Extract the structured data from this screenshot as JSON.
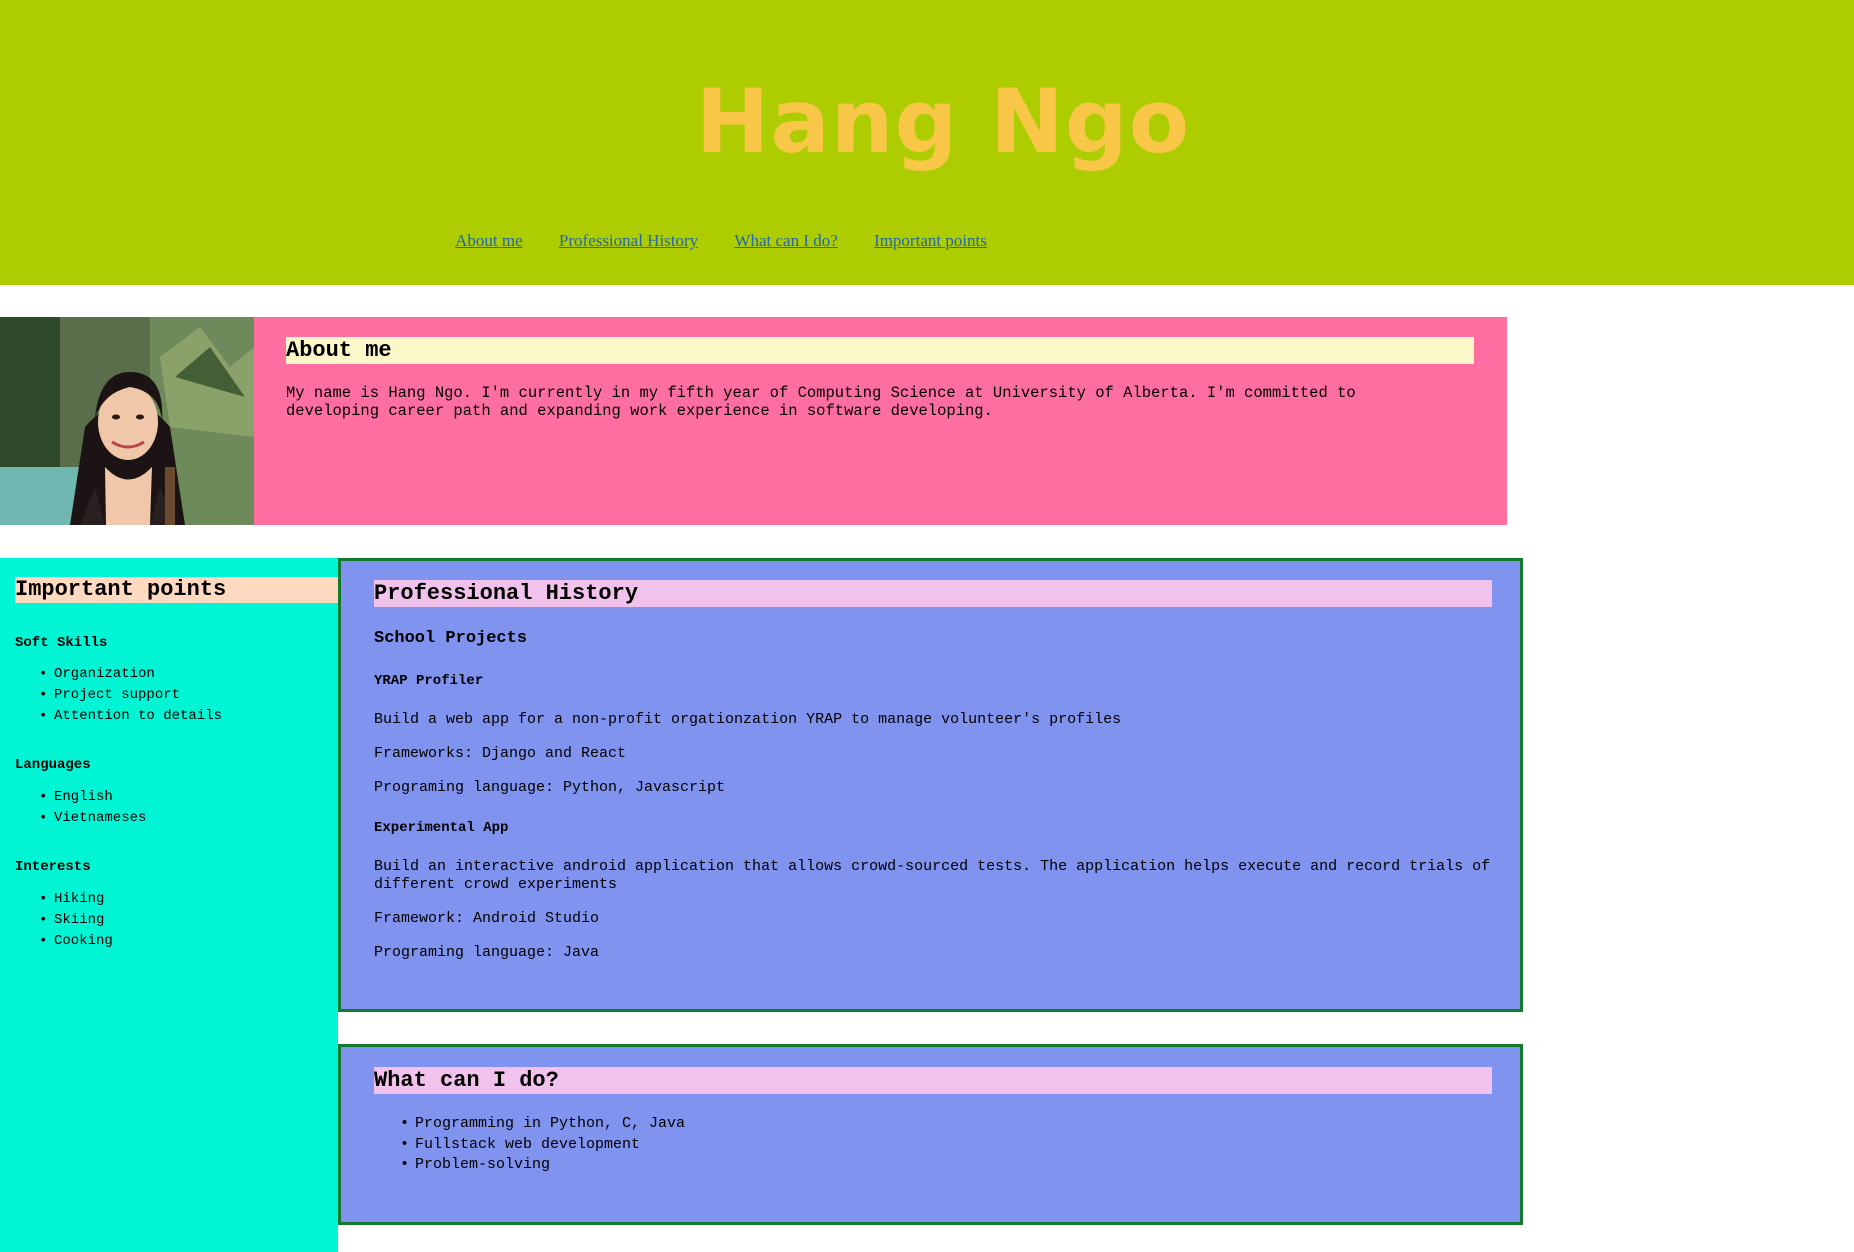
{
  "header": {
    "title": "Hang Ngo",
    "nav": [
      "About me",
      "Professional History",
      "What can I do?",
      "Important points"
    ],
    "bg_color": "#aecd00",
    "title_color": "#f9c747"
  },
  "about": {
    "title": "About me",
    "text": "My name is Hang Ngo. I'm currently in my fifth year of Computing Science at University of Alberta. I'm committed to developing career path and expanding work experience in software developing."
  },
  "important_points": {
    "title": "Important points",
    "groups": [
      {
        "heading": "Soft Skills",
        "items": [
          "Organization",
          "Project support",
          "Attention to details"
        ]
      },
      {
        "heading": "Languages",
        "items": [
          "English",
          "Vietnameses"
        ]
      },
      {
        "heading": "Interests",
        "items": [
          "Hiking",
          "Skiing",
          "Cooking"
        ]
      }
    ]
  },
  "professional_history": {
    "title": "Professional History",
    "subtitle": "School Projects",
    "projects": [
      {
        "name": "YRAP Profiler",
        "description": "Build a web app for a non-profit orgationzation YRAP to manage volunteer's profiles",
        "frameworks": "Frameworks: Django and React",
        "language": "Programing language: Python, Javascript"
      },
      {
        "name": "Experimental App",
        "description": "Build an interactive android application that allows crowd-sourced tests. The application helps execute and record trials of different crowd experiments",
        "frameworks": "Framework: Android Studio",
        "language": "Programing language: Java"
      }
    ]
  },
  "what_can_i_do": {
    "title": "What can I do?",
    "items": [
      "Programming in Python, C, Java",
      "Fullstack web development",
      "Problem-solving"
    ]
  },
  "colors": {
    "about_bg": "#ff6ea0",
    "points_bg": "#00f5d4",
    "panel_bg": "#7f93ef",
    "panel_border": "#137a2b"
  }
}
